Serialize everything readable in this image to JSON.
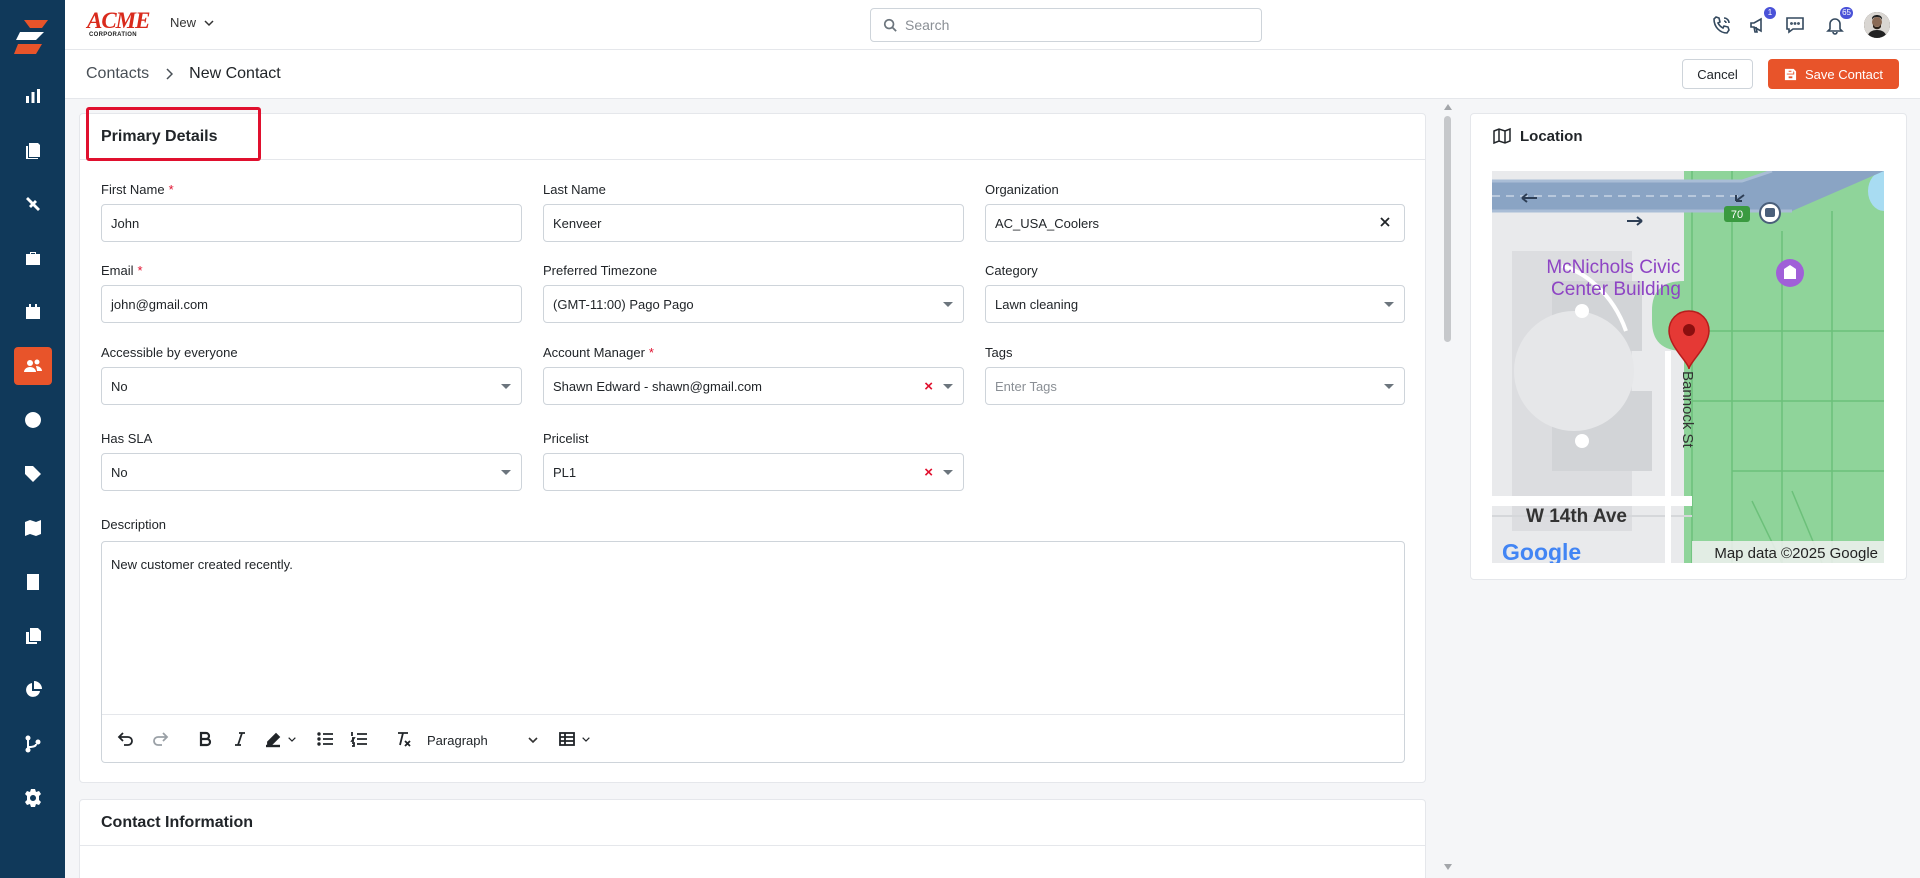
{
  "sidebar": {
    "items": [
      "dashboard",
      "tickets",
      "tools",
      "briefcase",
      "calendar",
      "contacts",
      "clock",
      "tag",
      "map",
      "receipt",
      "documents",
      "reports",
      "workflow",
      "settings"
    ],
    "active": "contacts"
  },
  "header": {
    "logo_text": "ACME",
    "logo_sub": "CORPORATION",
    "new_label": "New",
    "search_placeholder": "Search",
    "announcements_badge": "1",
    "notifications_badge": "65"
  },
  "breadcrumb": {
    "parent": "Contacts",
    "current": "New Contact"
  },
  "actions": {
    "cancel_label": "Cancel",
    "save_label": "Save Contact"
  },
  "primary": {
    "title": "Primary Details",
    "first_name_label": "First Name",
    "first_name_value": "John",
    "last_name_label": "Last Name",
    "last_name_value": "Kenveer",
    "organization_label": "Organization",
    "organization_value": "AC_USA_Coolers",
    "email_label": "Email",
    "email_value": "john@gmail.com",
    "timezone_label": "Preferred Timezone",
    "timezone_value": "(GMT-11:00) Pago Pago",
    "category_label": "Category",
    "category_value": "Lawn cleaning",
    "accessible_label": "Accessible by everyone",
    "accessible_value": "No",
    "account_manager_label": "Account Manager",
    "account_manager_value": "Shawn Edward - shawn@gmail.com",
    "tags_label": "Tags",
    "tags_placeholder": "Enter Tags",
    "sla_label": "Has SLA",
    "sla_value": "No",
    "pricelist_label": "Pricelist",
    "pricelist_value": "PL1",
    "required_mark": "*",
    "description_label": "Description",
    "description_value": "New customer created recently.",
    "paragraph_label": "Paragraph"
  },
  "contact_info": {
    "title": "Contact Information"
  },
  "location": {
    "title": "Location",
    "map": {
      "building": "McNichols Civic Center Building",
      "street_vertical": "Bannock St",
      "street_horizontal": "W 14th Ave",
      "route": "70",
      "attribution": "Map data ©2025 Google",
      "google": "Google"
    }
  },
  "colors": {
    "sidebar": "#10395a",
    "accent": "#e8542a",
    "highlight": "#e0102e",
    "badge": "#4a52d8"
  }
}
